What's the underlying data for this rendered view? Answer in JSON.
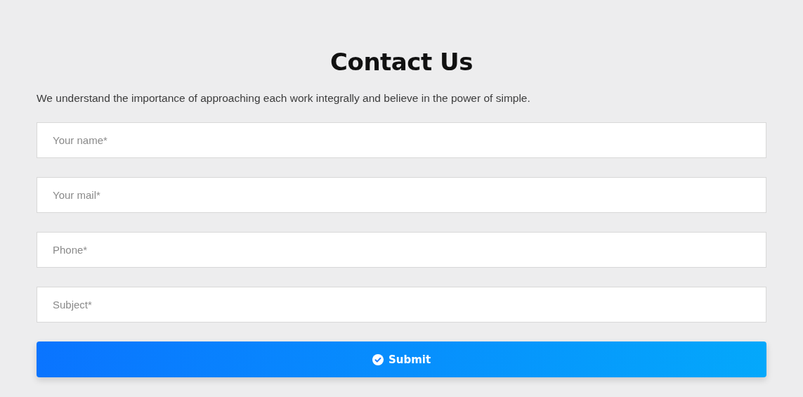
{
  "title": "Contact Us",
  "intro": "We understand the importance of approaching each work integrally and believe in the power of simple.",
  "fields": [
    {
      "placeholder": "Your name*"
    },
    {
      "placeholder": "Your mail*"
    },
    {
      "placeholder": "Phone*"
    },
    {
      "placeholder": "Subject*"
    }
  ],
  "submit": {
    "label": "Submit"
  }
}
